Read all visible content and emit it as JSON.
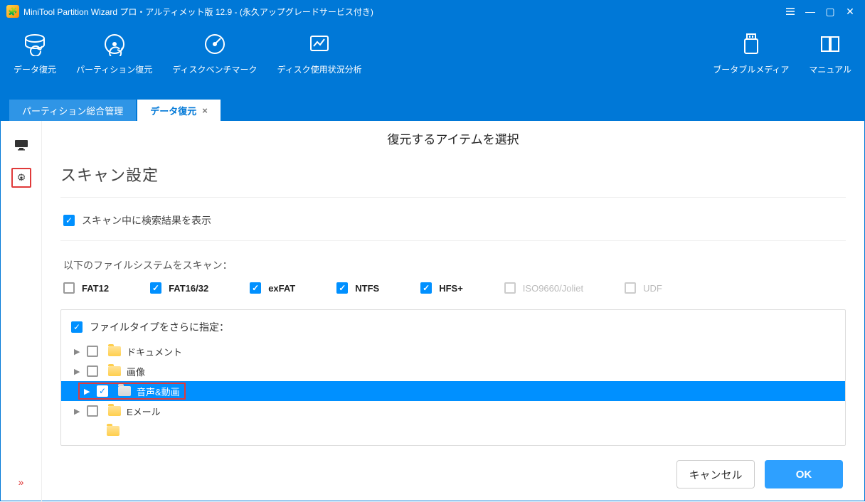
{
  "title": "MiniTool Partition Wizard プロ・アルティメット版 12.9 - (永久アップグレードサービス付き)",
  "ribbon": {
    "items": [
      {
        "label": "データ復元"
      },
      {
        "label": "パーティション復元"
      },
      {
        "label": "ディスクベンチマーク"
      },
      {
        "label": "ディスク使用状況分析"
      }
    ],
    "right": [
      {
        "label": "ブータブルメディア"
      },
      {
        "label": "マニュアル"
      }
    ]
  },
  "tabs": {
    "inactive": "パーティション総合管理",
    "active": "データ復元"
  },
  "content": {
    "page_title": "復元するアイテムを選択",
    "section_title": "スキャン設定",
    "show_results_label": "スキャン中に検索結果を表示",
    "fs_heading": "以下のファイルシステムをスキャン：",
    "fs": {
      "fat12": "FAT12",
      "fat1632": "FAT16/32",
      "exfat": "exFAT",
      "ntfs": "NTFS",
      "hfs": "HFS+",
      "iso": "ISO9660/Joliet",
      "udf": "UDF"
    },
    "filetype_header": "ファイルタイプをさらに指定：",
    "tree": {
      "documents": "ドキュメント",
      "images": "画像",
      "audio_video": "音声&動画",
      "email": "Eメール"
    },
    "cancel": "キャンセル",
    "ok": "OK"
  }
}
